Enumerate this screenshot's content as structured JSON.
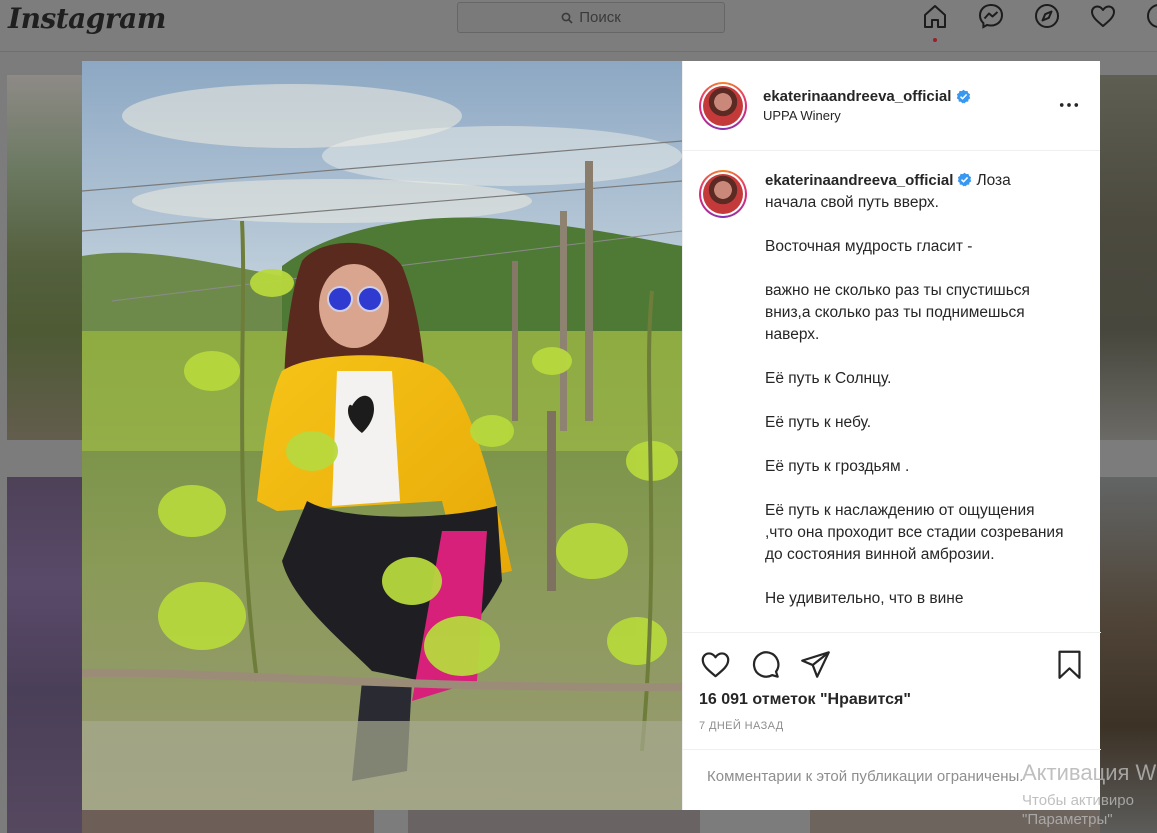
{
  "app": {
    "logo": "Instagram"
  },
  "search": {
    "placeholder": "Поиск"
  },
  "nav": {
    "icons": [
      "home-icon",
      "messenger-icon",
      "explore-icon",
      "heart-icon"
    ],
    "active": "home-icon"
  },
  "post": {
    "username": "ekaterinaandreeva_official",
    "verified": true,
    "location": "UPPA Winery",
    "caption_first": "Лоза начала свой путь вверх.",
    "caption_rest": "\n\nВосточная мудрость гласит -\n\nважно не сколько раз ты спустишься вниз,а сколько раз ты поднимешься наверх.\n\nЕё путь к Солнцу.\n\nЕё путь к небу.\n\nЕё путь к гроздьям .\n\nЕё путь к наслаждению от ощущения ,что она проходит все стадии созревания до состояния винной амброзии.\n\nНе удивительно, что в вине",
    "likes": "16 091 отметок \"Нравится\"",
    "timestamp": "7 ДНЕЙ НАЗАД",
    "comments_restricted": "Комментарии к этой публикации ограничены."
  },
  "actions": [
    "like-icon",
    "comment-icon",
    "share-icon",
    "bookmark-icon"
  ],
  "colors": {
    "verified_blue": "#3897f0",
    "text": "#262626",
    "muted": "#8e8e8e",
    "ring_start": "#f58529",
    "ring_end": "#dd2a7b"
  },
  "windows_activation": {
    "title": "Активация W",
    "line1": "Чтобы активиро",
    "line2": "\"Параметры\""
  }
}
